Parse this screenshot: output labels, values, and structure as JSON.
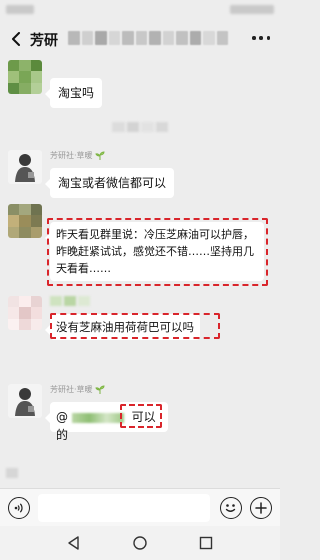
{
  "header": {
    "title": "芳研"
  },
  "messages": [
    {
      "text": "淘宝吗"
    },
    {
      "nickname": "芳研社·草暖",
      "text": "淘宝或者微信都可以"
    },
    {
      "text": "昨天看见群里说：冷压芝麻油可以护唇，昨晚赶紧试试，感觉还不错……坚持用几天看看……"
    },
    {
      "text": "没有芝麻油用荷荷巴可以吗"
    },
    {
      "nickname": "芳研社·草暖",
      "mention": "@",
      "text": "可以的"
    }
  ],
  "icons": {
    "back": "chevron-left-icon",
    "more": "more-dots-icon",
    "voice": "voice-icon",
    "emoji": "emoji-icon",
    "plus": "plus-icon",
    "nav_back": "triangle-back-icon",
    "nav_home": "circle-home-icon",
    "nav_recent": "square-recent-icon"
  },
  "colors": {
    "background": "#ededed",
    "bubble": "#ffffff",
    "highlight_dash": "#d9252b",
    "nickname": "#9a9a9a"
  }
}
